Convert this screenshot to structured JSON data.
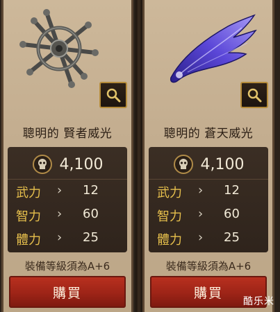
{
  "items": [
    {
      "name": "聰明的 賢者威光",
      "art": "wheel-spokes",
      "price": "4,100",
      "stats": [
        {
          "label": "武力",
          "arrow": "›",
          "value": "12"
        },
        {
          "label": "智力",
          "arrow": "›",
          "value": "60"
        },
        {
          "label": "體力",
          "arrow": "›",
          "value": "25"
        }
      ],
      "requirement": "裝備等級須為A+6",
      "buy_label": "購買"
    },
    {
      "name": "聰明的 蒼天威光",
      "art": "blue-wing",
      "price": "4,100",
      "stats": [
        {
          "label": "武力",
          "arrow": "›",
          "value": "12"
        },
        {
          "label": "智力",
          "arrow": "›",
          "value": "60"
        },
        {
          "label": "體力",
          "arrow": "›",
          "value": "25"
        }
      ],
      "requirement": "裝備等級須為A+6",
      "buy_label": "購買"
    }
  ],
  "watermark": "酷乐米",
  "colors": {
    "stat_label": "#e6bf4c",
    "buy_button": "#9d2417",
    "panel": "#342820",
    "card": "#c7b294"
  }
}
